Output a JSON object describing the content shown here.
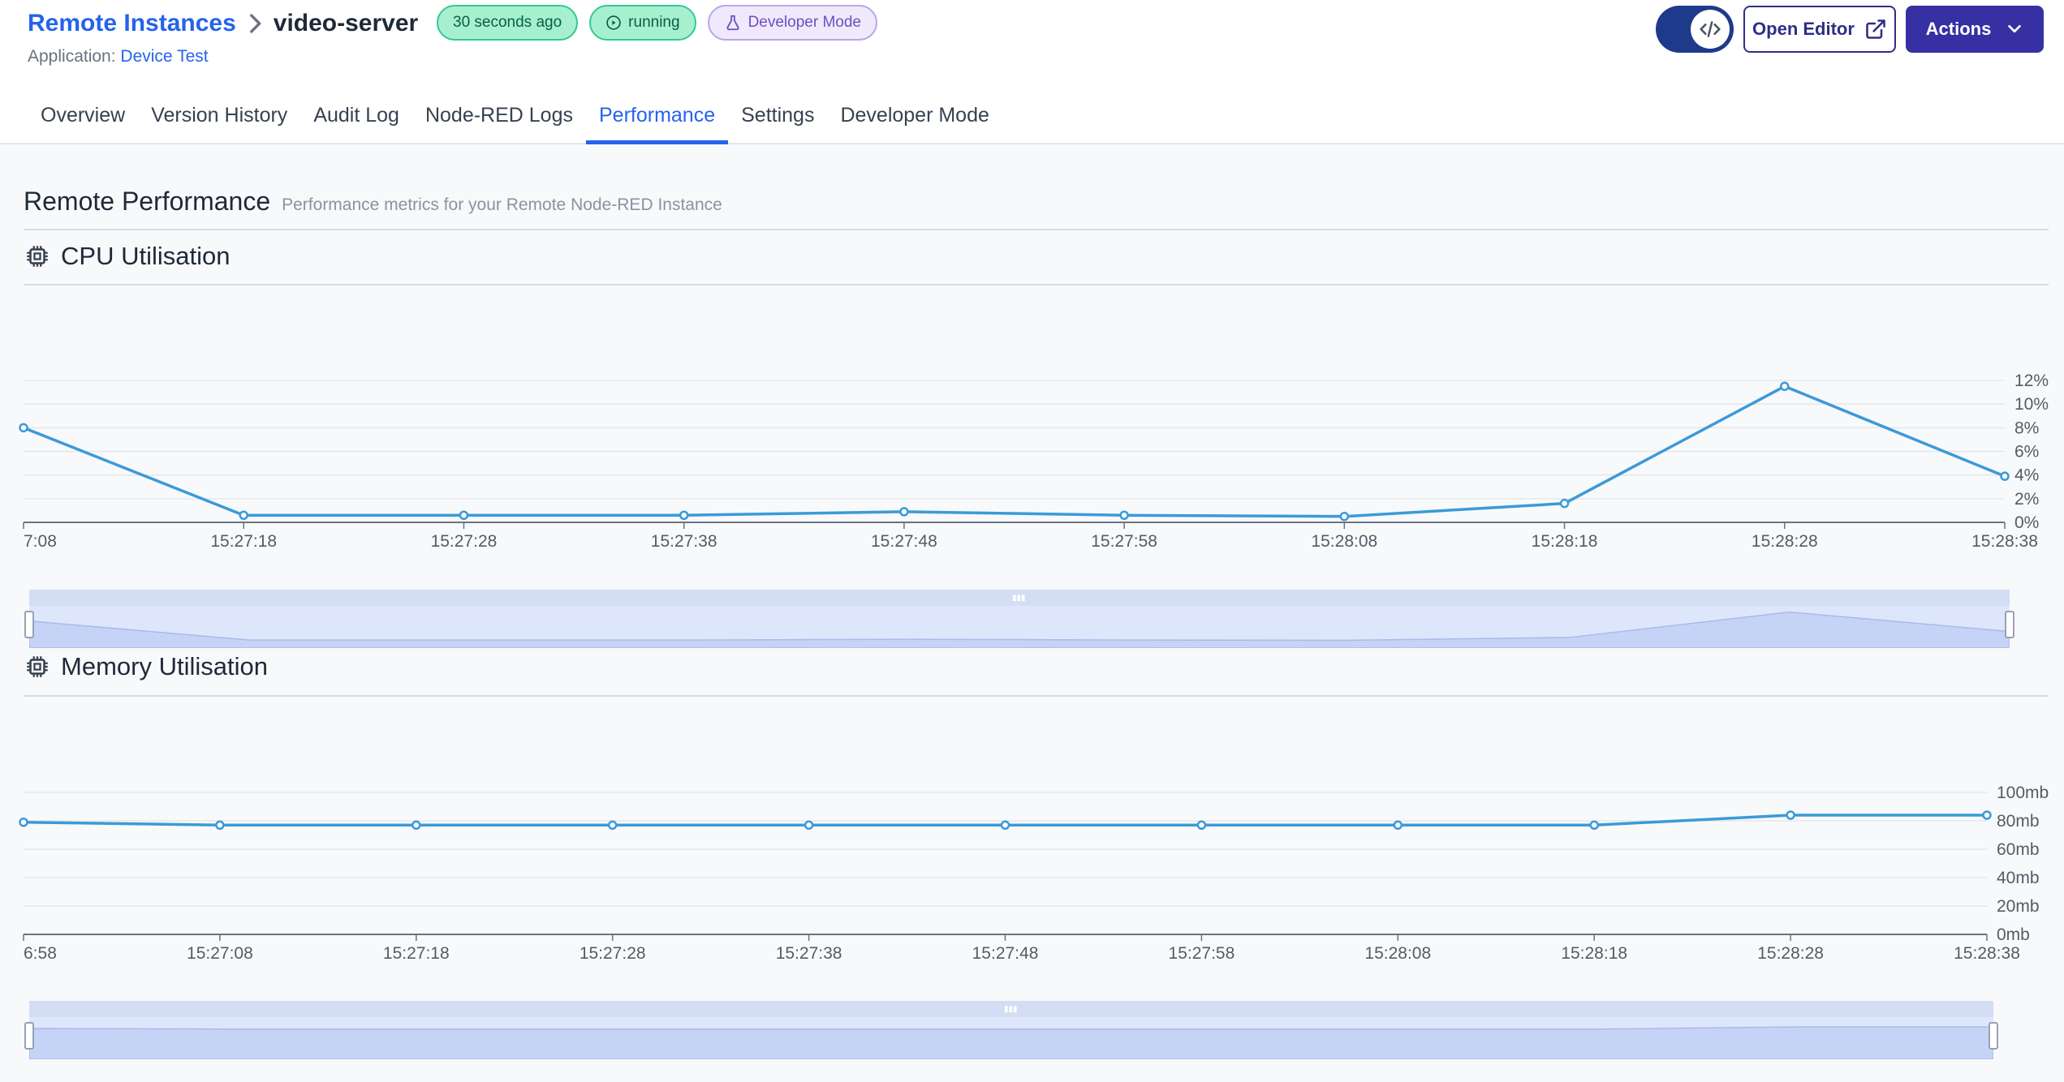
{
  "header": {
    "breadcrumb": {
      "parent": "Remote Instances",
      "current": "video-server"
    },
    "application_label": "Application:",
    "application_name": "Device Test",
    "badges": {
      "time": "30 seconds ago",
      "status": "running",
      "mode": "Developer Mode"
    },
    "open_editor": "Open Editor",
    "actions": "Actions"
  },
  "tabs": [
    {
      "label": "Overview"
    },
    {
      "label": "Version History"
    },
    {
      "label": "Audit Log"
    },
    {
      "label": "Node-RED Logs"
    },
    {
      "label": "Performance",
      "active": true
    },
    {
      "label": "Settings"
    },
    {
      "label": "Developer Mode"
    }
  ],
  "section": {
    "title": "Remote Performance",
    "subtitle": "Performance metrics for your Remote Node-RED Instance"
  },
  "colors": {
    "accent": "#2563eb",
    "line": "#3b9ad9",
    "primary_button": "#3730a3",
    "badge_green": "#a7f0cf"
  },
  "chart_data": [
    {
      "type": "line",
      "title": "CPU Utilisation",
      "x": [
        "7:08",
        "15:27:18",
        "15:27:28",
        "15:27:38",
        "15:27:48",
        "15:27:58",
        "15:28:08",
        "15:28:18",
        "15:28:28",
        "15:28:38"
      ],
      "series": [
        {
          "values": [
            8,
            0.6,
            0.6,
            0.6,
            0.9,
            0.6,
            0.5,
            1.6,
            11.5,
            3.9
          ]
        }
      ],
      "yticks": [
        "0%",
        "2%",
        "4%",
        "6%",
        "8%",
        "10%",
        "12%"
      ],
      "ylim": [
        0,
        12
      ],
      "grid": true,
      "y_axis_side": "right"
    },
    {
      "type": "line",
      "title": "Memory Utilisation",
      "x": [
        "6:58",
        "15:27:08",
        "15:27:18",
        "15:27:28",
        "15:27:38",
        "15:27:48",
        "15:27:58",
        "15:28:08",
        "15:28:18",
        "15:28:28",
        "15:28:38"
      ],
      "series": [
        {
          "values": [
            79,
            77,
            77,
            77,
            77,
            77,
            77,
            77,
            77,
            84,
            84
          ]
        }
      ],
      "yticks": [
        "0mb",
        "20mb",
        "40mb",
        "60mb",
        "80mb",
        "100mb"
      ],
      "ylim": [
        0,
        100
      ],
      "grid": true,
      "y_axis_side": "right"
    }
  ]
}
